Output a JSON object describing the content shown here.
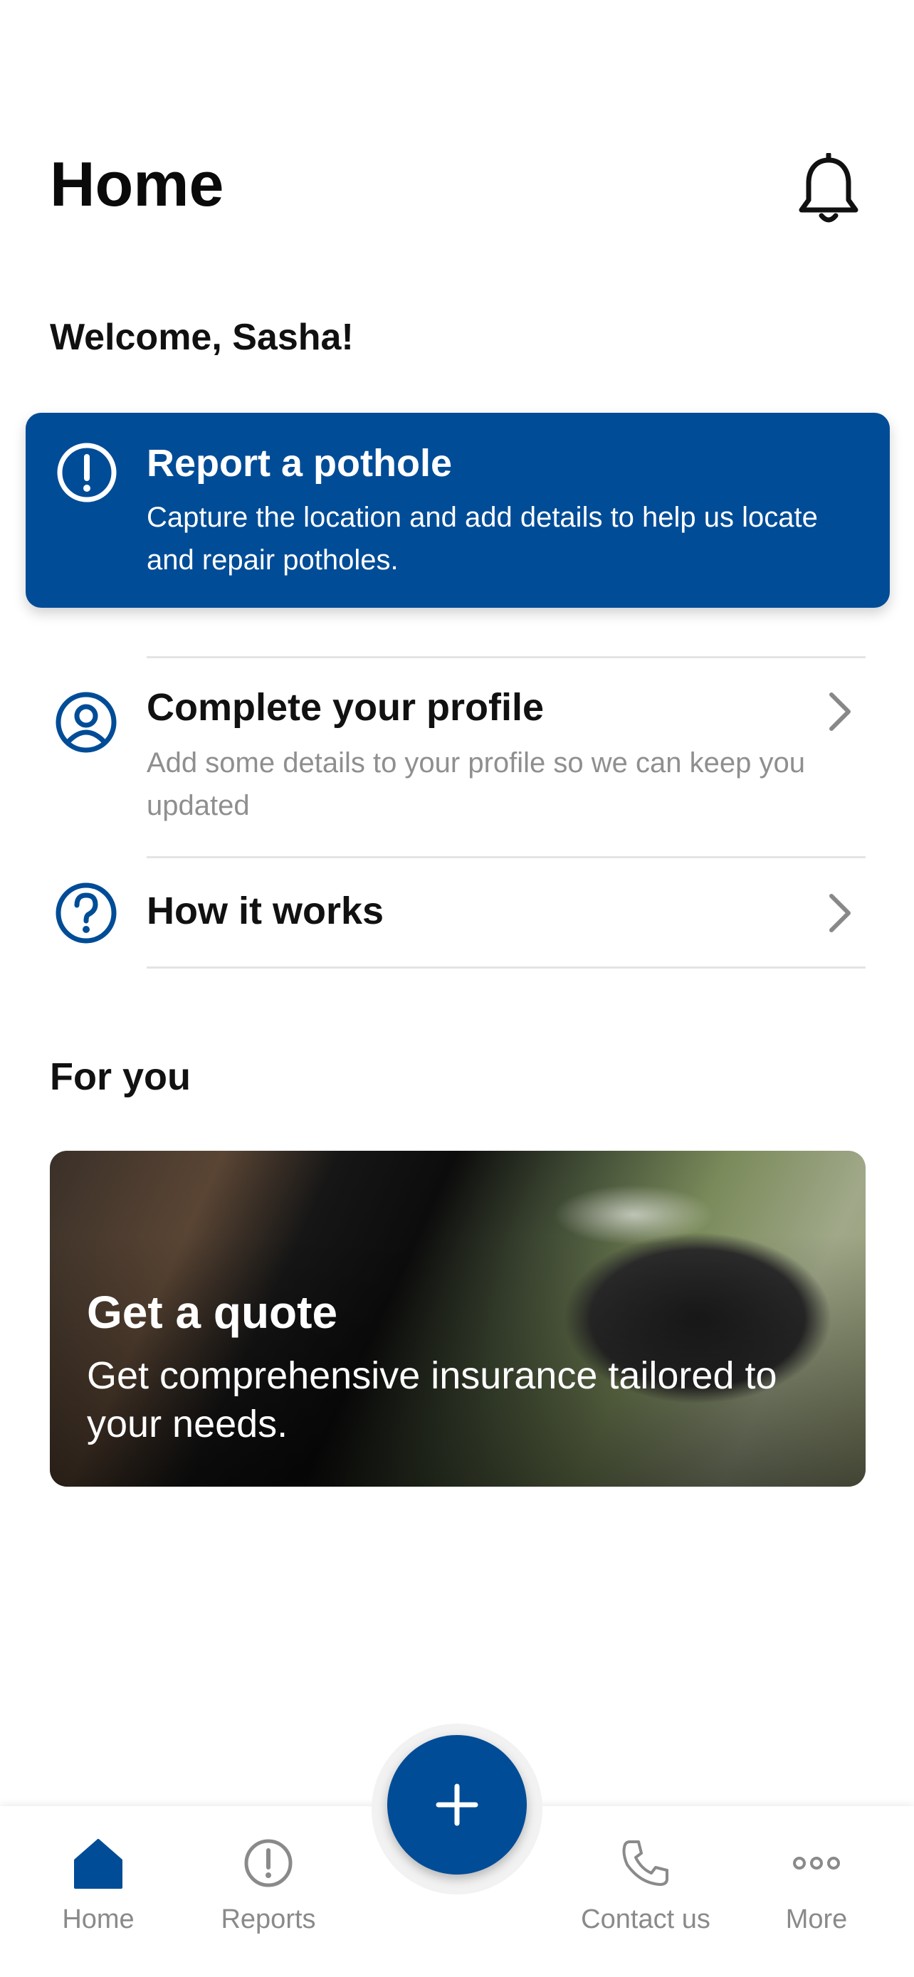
{
  "header": {
    "title": "Home",
    "notification_icon": "bell-icon"
  },
  "welcome": "Welcome, Sasha!",
  "report_banner": {
    "icon": "alert-circle-icon",
    "title": "Report a pothole",
    "description": "Capture the location and add details to help us locate and repair potholes.",
    "color": "#004c97"
  },
  "list": [
    {
      "icon": "profile-icon",
      "title": "Complete your profile",
      "subtitle": "Add some details to your profile so we can keep you updated"
    },
    {
      "icon": "help-icon",
      "title": "How it works"
    }
  ],
  "for_you": {
    "heading": "For you",
    "card": {
      "title": "Get a quote",
      "description": "Get comprehensive insurance tailored to your needs."
    }
  },
  "fab": {
    "icon": "plus-icon"
  },
  "tabs": [
    {
      "label": "Home",
      "icon": "home-icon",
      "active": true
    },
    {
      "label": "Reports",
      "icon": "alert-circle-icon"
    },
    {
      "label": "Contact us",
      "icon": "phone-icon"
    },
    {
      "label": "More",
      "icon": "more-icon"
    }
  ],
  "colors": {
    "primary": "#004c97",
    "muted_text": "#8f8f8f"
  }
}
